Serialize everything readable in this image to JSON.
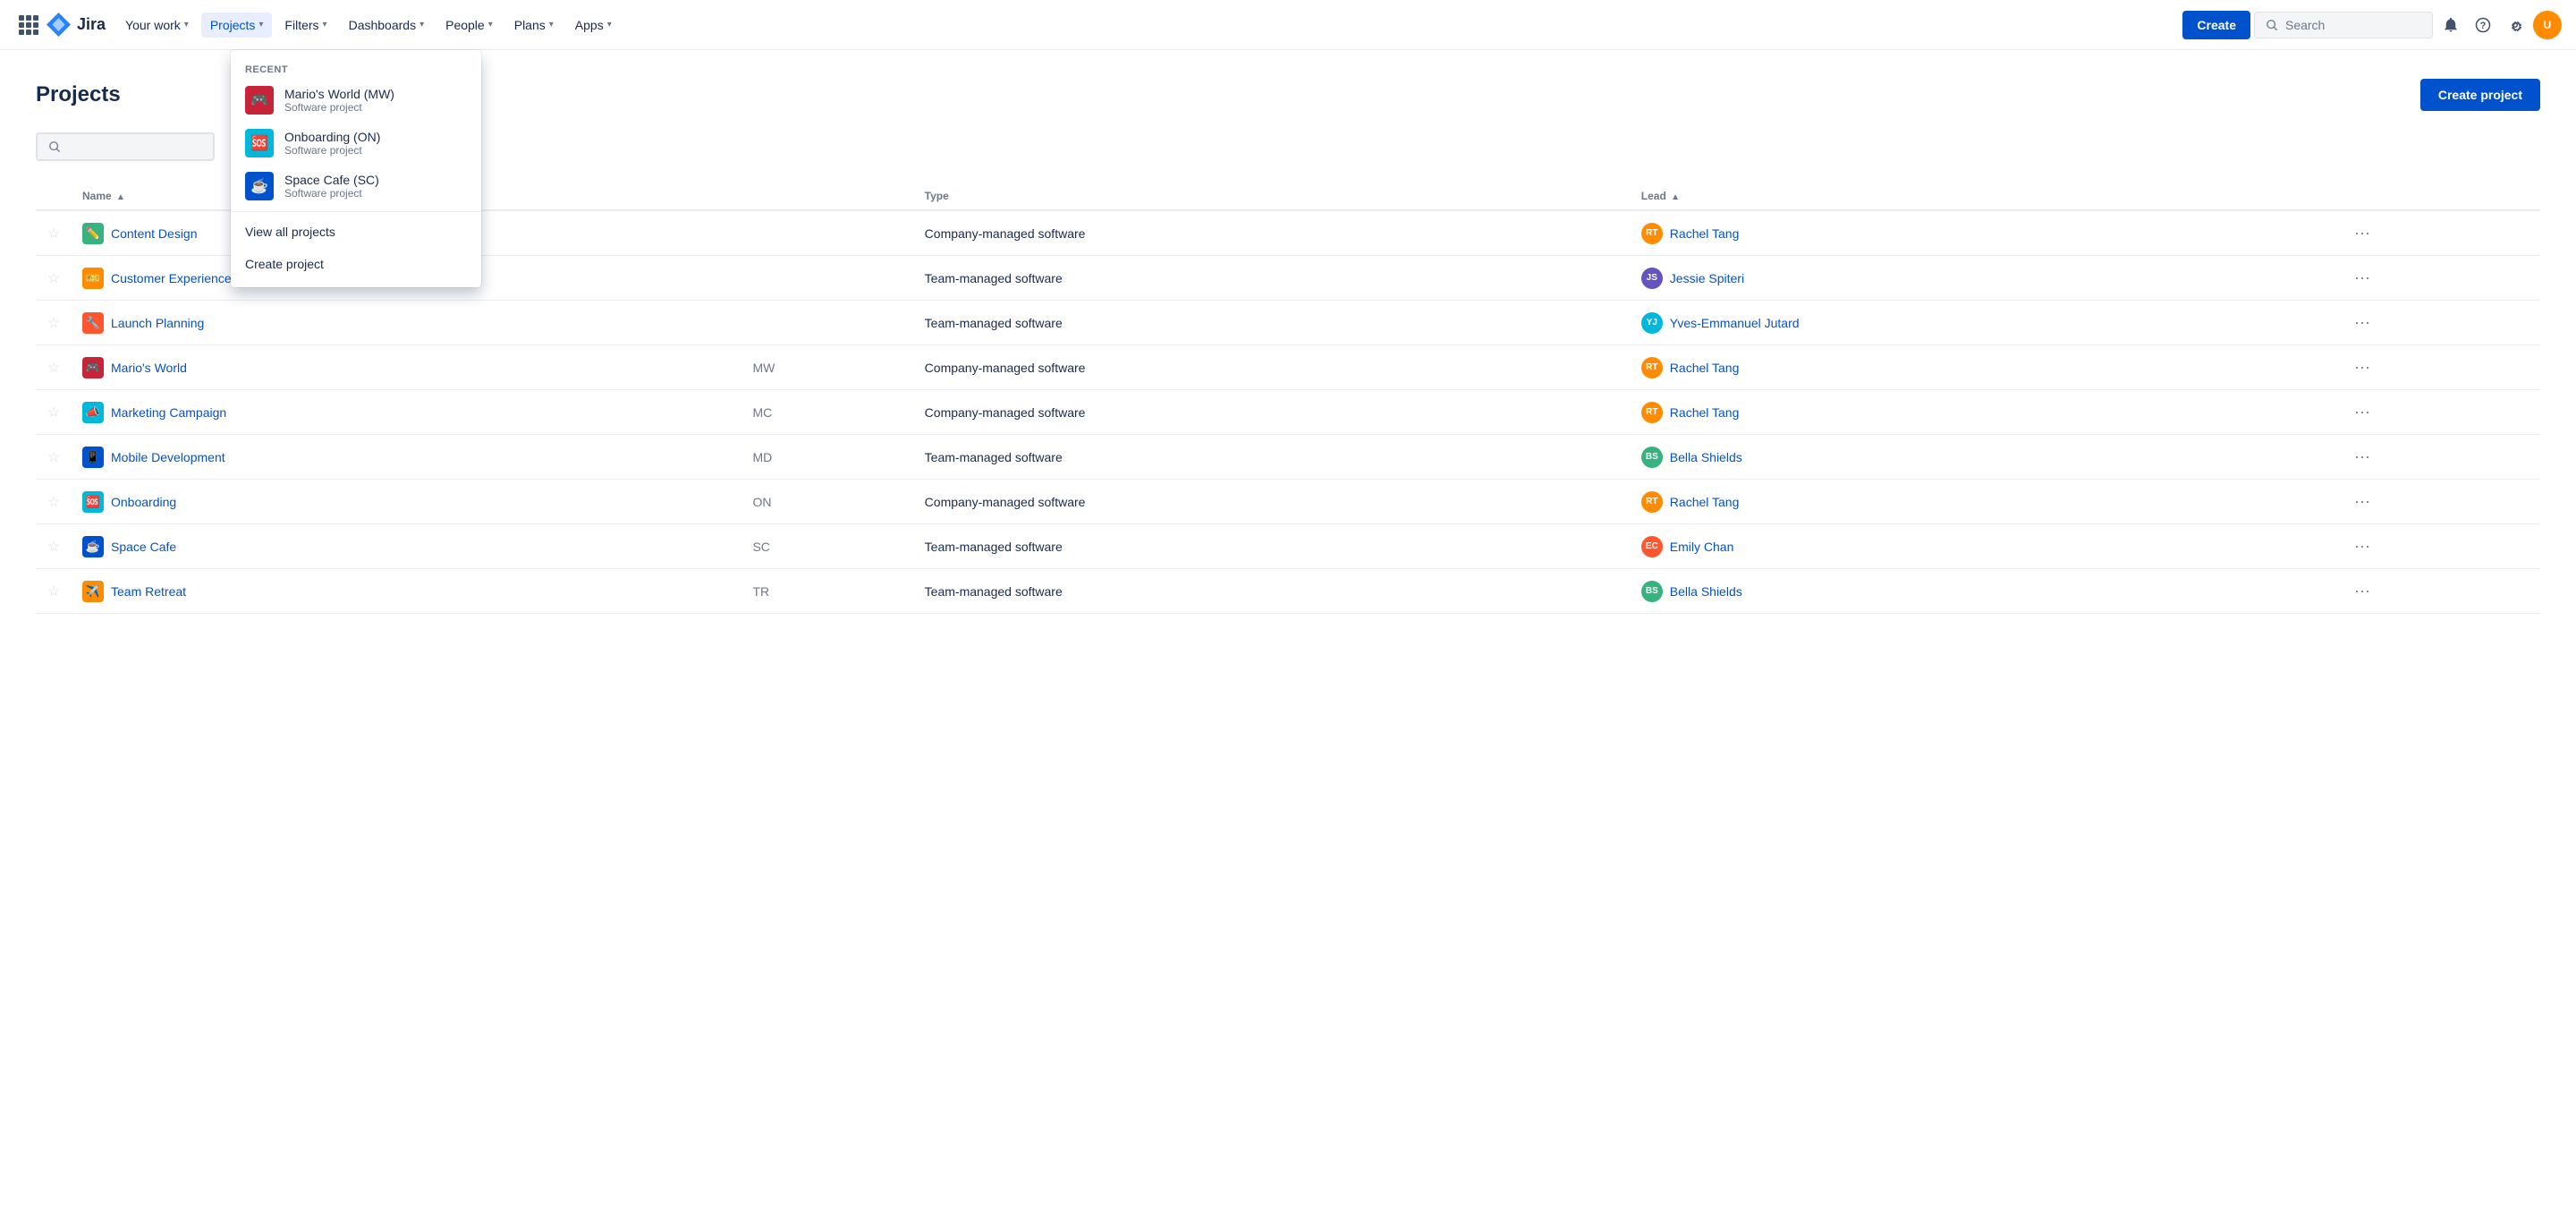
{
  "nav": {
    "logo_text": "Jira",
    "items": [
      {
        "id": "your-work",
        "label": "Your work",
        "has_chevron": true,
        "active": false
      },
      {
        "id": "projects",
        "label": "Projects",
        "has_chevron": true,
        "active": true
      },
      {
        "id": "filters",
        "label": "Filters",
        "has_chevron": true,
        "active": false
      },
      {
        "id": "dashboards",
        "label": "Dashboards",
        "has_chevron": true,
        "active": false
      },
      {
        "id": "people",
        "label": "People",
        "has_chevron": true,
        "active": false
      },
      {
        "id": "plans",
        "label": "Plans",
        "has_chevron": true,
        "active": false
      },
      {
        "id": "apps",
        "label": "Apps",
        "has_chevron": true,
        "active": false
      }
    ],
    "create_label": "Create",
    "search_placeholder": "Search"
  },
  "dropdown": {
    "recent_label": "RECENT",
    "recent_items": [
      {
        "id": "marios-world",
        "name": "Mario's World (MW)",
        "sub": "Software project",
        "color": "#C7243A",
        "icon": "🎮"
      },
      {
        "id": "onboarding",
        "name": "Onboarding (ON)",
        "sub": "Software project",
        "color": "#00B8D9",
        "icon": "🆘"
      },
      {
        "id": "space-cafe",
        "name": "Space Cafe (SC)",
        "sub": "Software project",
        "color": "#0052CC",
        "icon": "☕"
      }
    ],
    "view_all_label": "View all projects",
    "create_project_label": "Create project"
  },
  "page": {
    "title": "Projects",
    "create_project_label": "Create project",
    "search_placeholder": "",
    "columns": [
      {
        "id": "star",
        "label": ""
      },
      {
        "id": "name",
        "label": "Name",
        "sort": true
      },
      {
        "id": "key",
        "label": ""
      },
      {
        "id": "type",
        "label": "Type"
      },
      {
        "id": "lead",
        "label": "Lead",
        "sort": true
      },
      {
        "id": "actions",
        "label": ""
      }
    ],
    "projects": [
      {
        "id": "content-design",
        "name": "Content Design",
        "key": "",
        "type": "Company-managed software",
        "lead": "Rachel Tang",
        "icon_bg": "#36B37E",
        "icon_text": "✏️",
        "icon_color": "#fff"
      },
      {
        "id": "customer-exp",
        "name": "Customer Experience",
        "key": "",
        "type": "Team-managed software",
        "lead": "Jessie Spiteri",
        "icon_bg": "#FF8B00",
        "icon_text": "🎫",
        "icon_color": "#fff"
      },
      {
        "id": "launch-planning",
        "name": "Launch Planning",
        "key": "",
        "type": "Team-managed software",
        "lead": "Yves-Emmanuel Jutard",
        "icon_bg": "#FF5630",
        "icon_text": "🔧",
        "icon_color": "#fff"
      },
      {
        "id": "marios-world",
        "name": "Mario's World",
        "key": "MW",
        "type": "Company-managed software",
        "lead": "Rachel Tang",
        "icon_bg": "#C7243A",
        "icon_text": "🎮",
        "icon_color": "#fff"
      },
      {
        "id": "marketing-campaign",
        "name": "Marketing Campaign",
        "key": "MC",
        "type": "Company-managed software",
        "lead": "Rachel Tang",
        "icon_bg": "#00B8D9",
        "icon_text": "📣",
        "icon_color": "#fff"
      },
      {
        "id": "mobile-development",
        "name": "Mobile Development",
        "key": "MD",
        "type": "Team-managed software",
        "lead": "Bella Shields",
        "icon_bg": "#0052CC",
        "icon_text": "📱",
        "icon_color": "#fff"
      },
      {
        "id": "onboarding",
        "name": "Onboarding",
        "key": "ON",
        "type": "Company-managed software",
        "lead": "Rachel Tang",
        "icon_bg": "#00B8D9",
        "icon_text": "🆘",
        "icon_color": "#fff"
      },
      {
        "id": "space-cafe",
        "name": "Space Cafe",
        "key": "SC",
        "type": "Team-managed software",
        "lead": "Emily Chan",
        "icon_bg": "#0052CC",
        "icon_text": "☕",
        "icon_color": "#fff"
      },
      {
        "id": "team-retreat",
        "name": "Team Retreat",
        "key": "TR",
        "type": "Team-managed software",
        "lead": "Bella Shields",
        "icon_bg": "#FF8B00",
        "icon_text": "✈️",
        "icon_color": "#fff"
      }
    ]
  }
}
